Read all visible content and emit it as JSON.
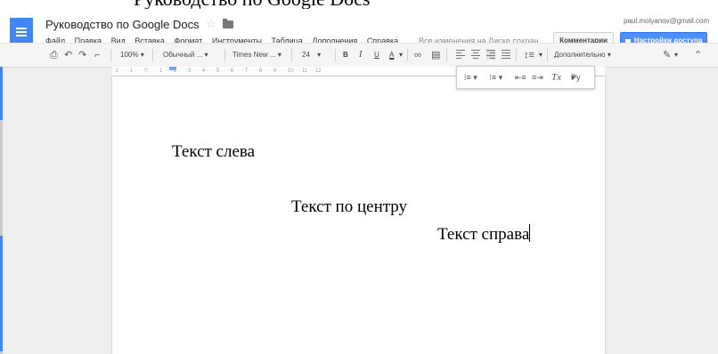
{
  "top_strip": {
    "text": "Руководство по Google Docs"
  },
  "header": {
    "title": "Руководство по Google Docs",
    "user_email": "paul.molyanov@gmail.com",
    "menu": [
      "Файл",
      "Правка",
      "Вид",
      "Вставка",
      "Формат",
      "Инструменты",
      "Таблица",
      "Дополнения",
      "Справка"
    ],
    "save_status": "Все изменения на Диске сохран...",
    "comments_label": "Комментарии",
    "share_label": "Настройки доступа",
    "logo_color": "#4285f4",
    "share_color": "#4d90fe"
  },
  "toolbar": {
    "zoom": "100%",
    "style": "Обычный ...",
    "font": "Times New ...",
    "size": "24",
    "bold": "B",
    "italic": "I",
    "underline": "U",
    "text_color": "A",
    "more": "Дополнительно",
    "icons": [
      "print-icon",
      "undo-icon",
      "redo-icon",
      "paint-format-icon",
      "link-icon",
      "comment-icon",
      "align-left-icon",
      "align-center-icon",
      "align-right-icon",
      "justify-icon",
      "line-spacing-icon",
      "pencil-icon",
      "collapse-icon"
    ]
  },
  "ruler": {
    "ticks": "· 2 · · · 1 · · · ▽ · · · 1 · · · 2 · · · 3 · · · 4 · · · 5 · · · 6 · · · 7 · · · 8 · · · 9 · · · 10 · · 11 · · 12"
  },
  "popup": {
    "clear_formatting": "Tx",
    "input_tools": "Ру",
    "icons": [
      "numbered-list-icon",
      "bulleted-list-icon",
      "decrease-indent-icon",
      "increase-indent-icon"
    ]
  },
  "document": {
    "lines": [
      "Текст слева",
      "Текст по центру",
      "Текст справа"
    ]
  }
}
